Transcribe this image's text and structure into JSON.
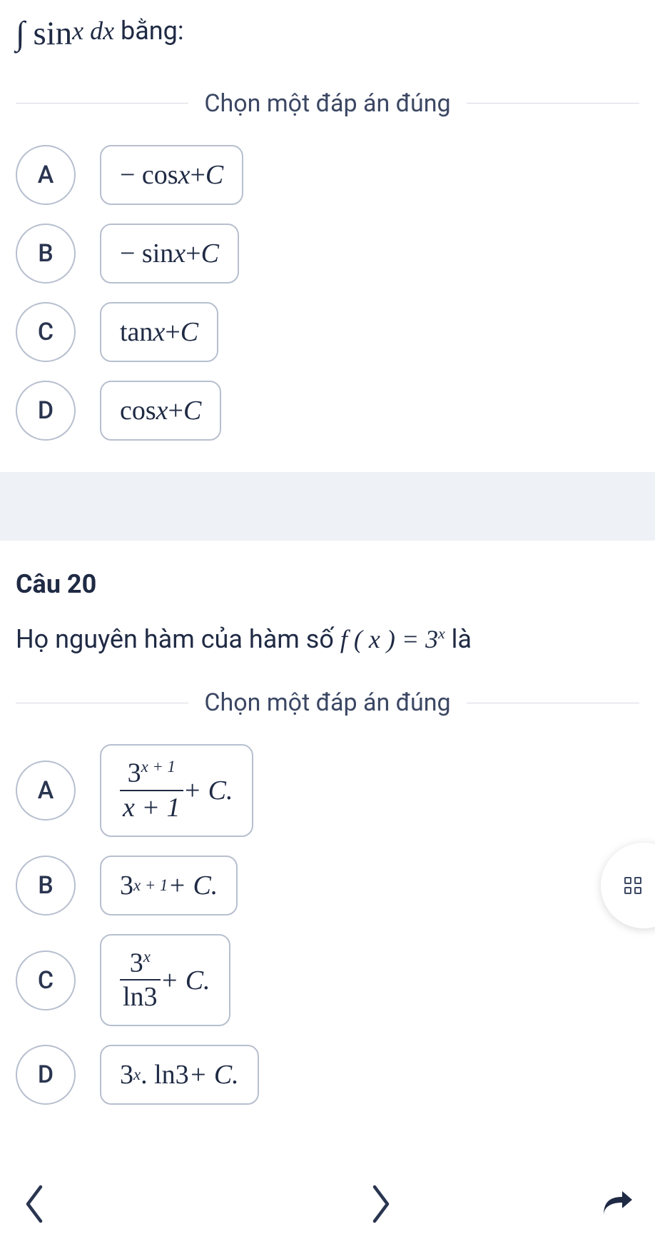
{
  "q19": {
    "stem_prefix": "∫ sin",
    "stem_var1": "x",
    "stem_dx_d": " d",
    "stem_dx_x": "x",
    "stem_suffix": " bằng:",
    "divider": "Chọn một đáp án đúng",
    "options": {
      "A": {
        "letter": "A",
        "expr_pre": "− cos",
        "expr_var": "x",
        "expr_post": " + ",
        "expr_C": "C"
      },
      "B": {
        "letter": "B",
        "expr_pre": "− sin",
        "expr_var": "x",
        "expr_post": " + ",
        "expr_C": "C"
      },
      "C": {
        "letter": "C",
        "expr_pre": "tan",
        "expr_var": "x",
        "expr_post": " + ",
        "expr_C": "C"
      },
      "D": {
        "letter": "D",
        "expr_pre": "cos",
        "expr_var": "x",
        "expr_post": " + ",
        "expr_C": "C"
      }
    }
  },
  "q20": {
    "number": "Câu 20",
    "stem_pre": "Họ nguyên hàm của hàm số ",
    "stem_f": "f ( x ) = 3",
    "stem_exp": "x",
    "stem_post": " là",
    "divider": "Chọn một đáp án đúng",
    "options": {
      "A": {
        "letter": "A",
        "num_base": "3",
        "num_exp": "x + 1",
        "den": "x + 1",
        "tail": " + C."
      },
      "B": {
        "letter": "B",
        "base": "3",
        "exp": "x + 1",
        "tail": " + C."
      },
      "C": {
        "letter": "C",
        "num_base": "3",
        "num_exp": "x",
        "den": "ln3",
        "tail": " + C."
      },
      "D": {
        "letter": "D",
        "base": "3",
        "exp": "x",
        "mid": " . ln3",
        "tail": " + C."
      }
    }
  }
}
